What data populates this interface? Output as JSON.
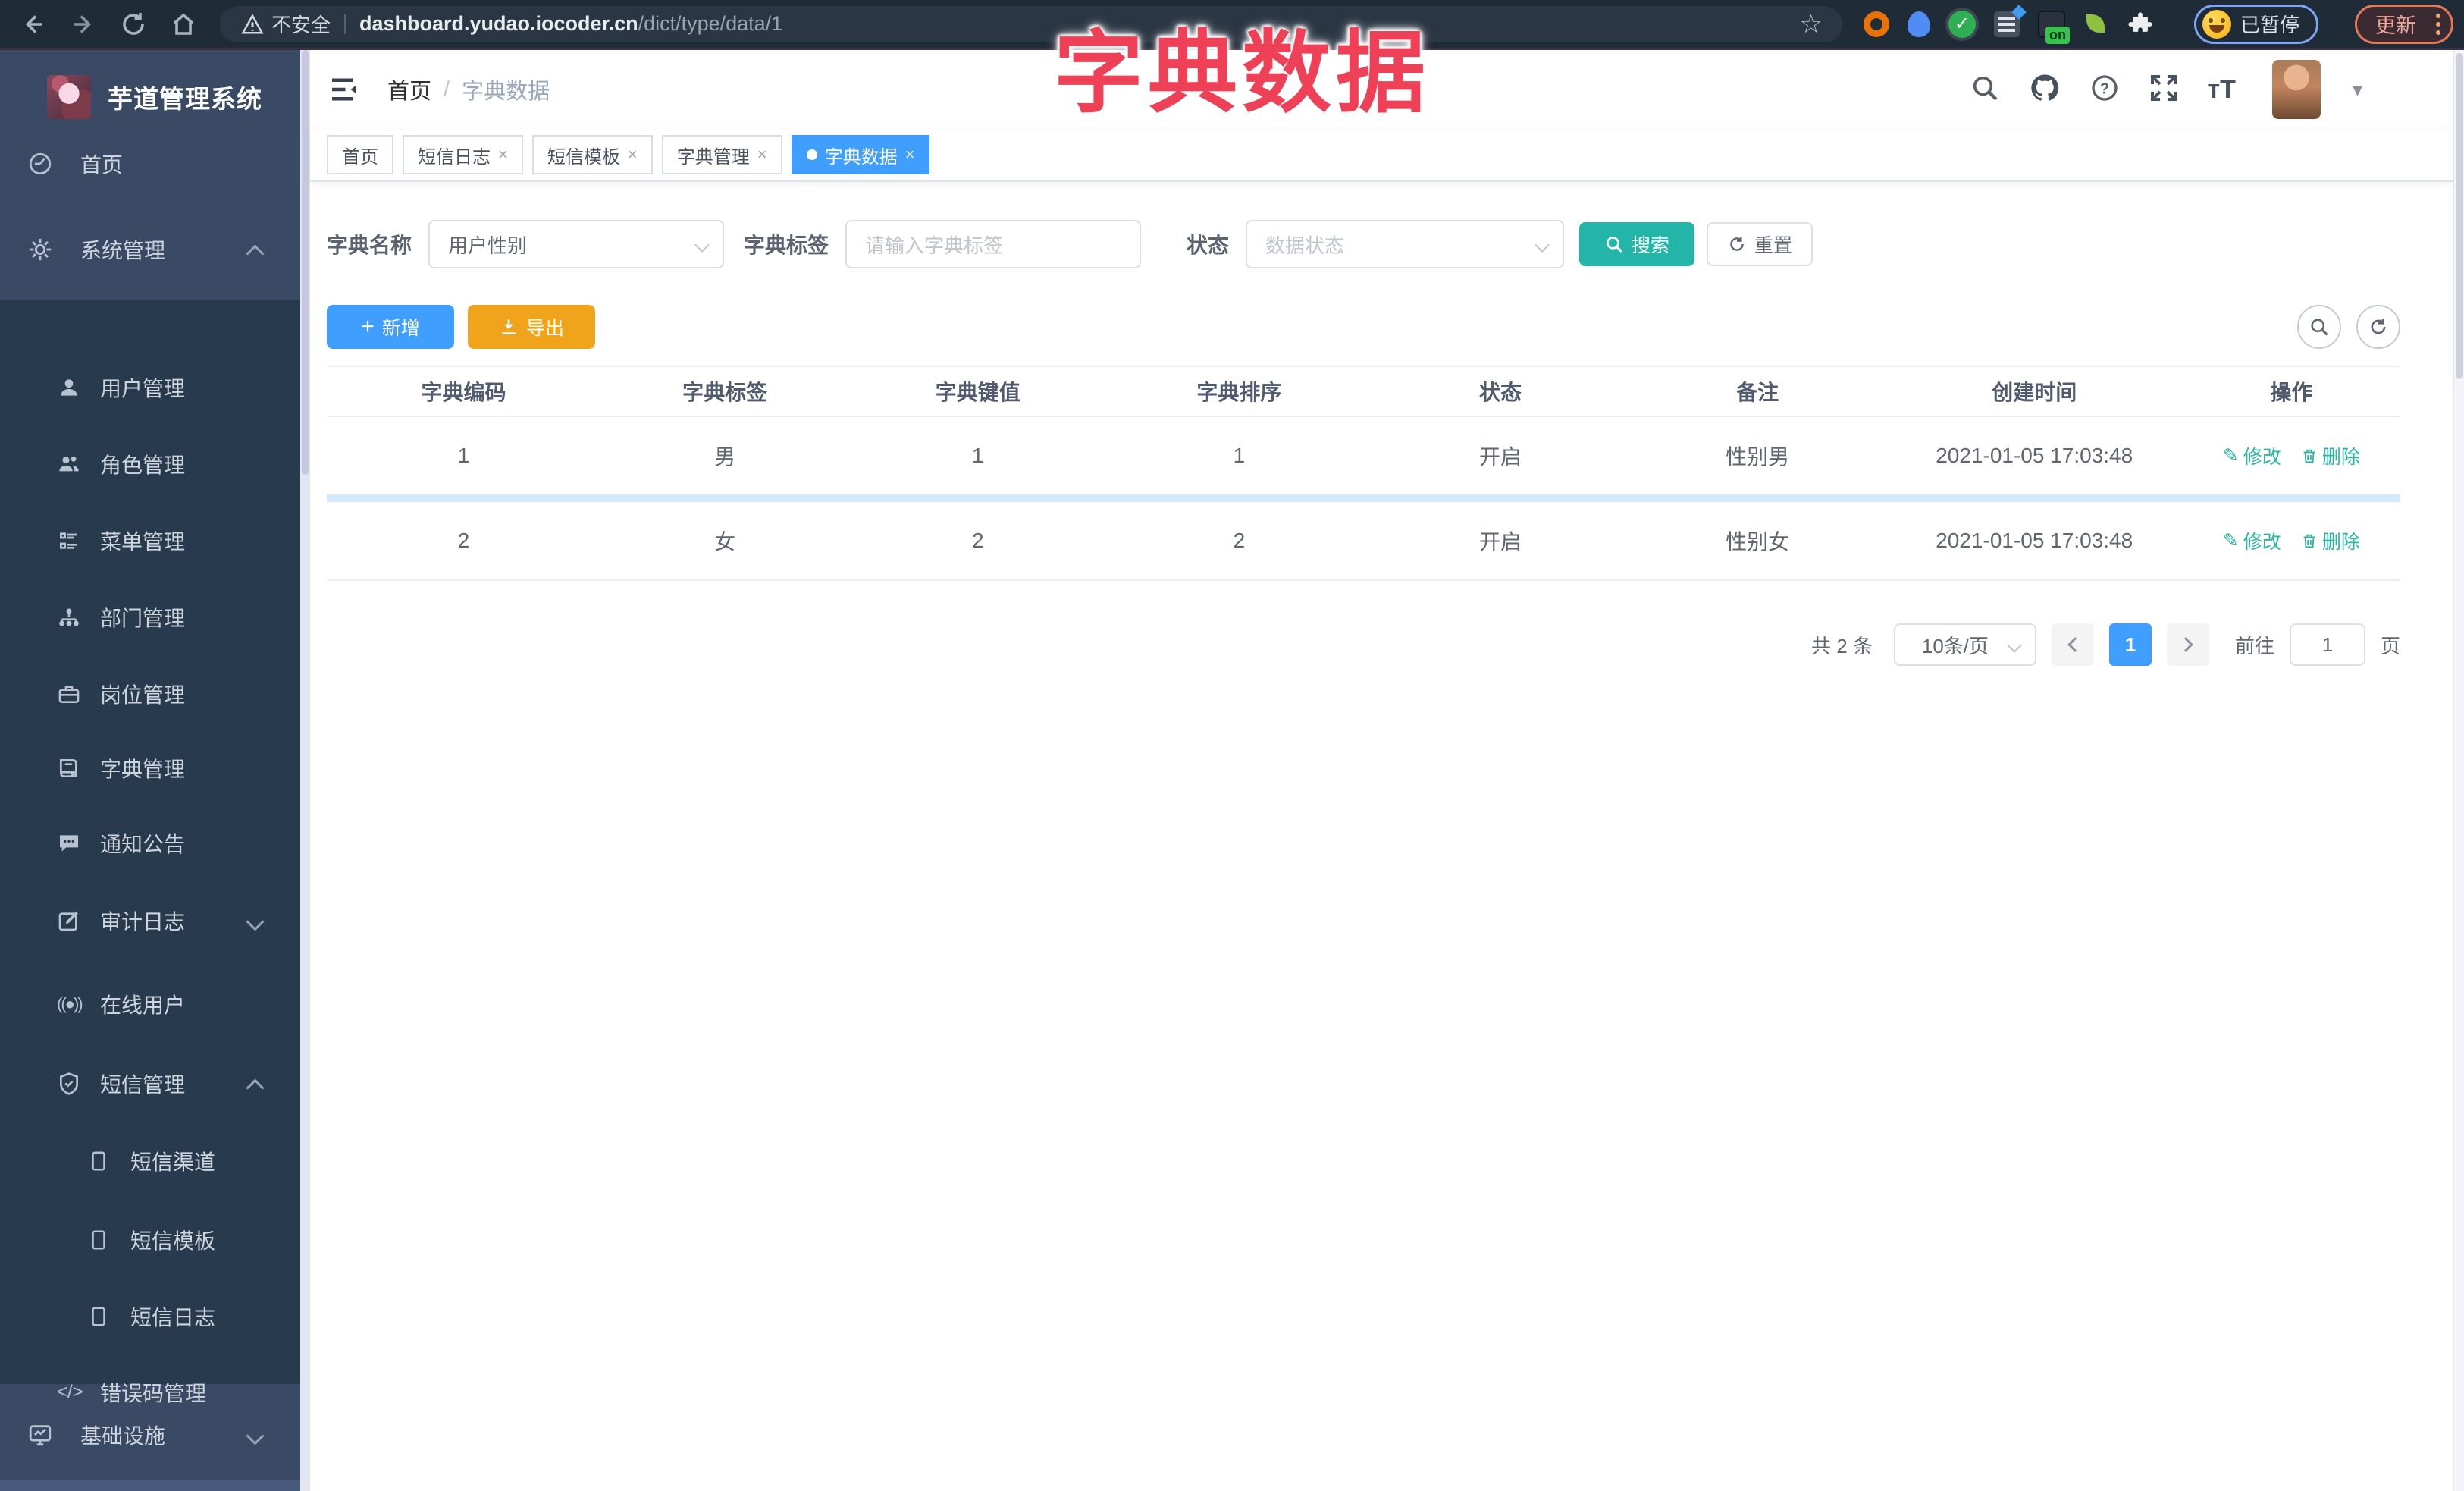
{
  "browser": {
    "security_label": "不安全",
    "url_host": "dashboard.yudao.iocoder.cn",
    "url_path": "/dict/type/data/1",
    "extension_on_badge": "on",
    "paused_badge": "已暂停",
    "update_button": "更新"
  },
  "overlay_title": "字典数据",
  "sidebar": {
    "logo_title": "芋道管理系统",
    "items": [
      {
        "label": "首页"
      },
      {
        "label": "系统管理"
      },
      {
        "label": "用户管理"
      },
      {
        "label": "角色管理"
      },
      {
        "label": "菜单管理"
      },
      {
        "label": "部门管理"
      },
      {
        "label": "岗位管理"
      },
      {
        "label": "字典管理"
      },
      {
        "label": "通知公告"
      },
      {
        "label": "审计日志"
      },
      {
        "label": "在线用户"
      },
      {
        "label": "短信管理"
      },
      {
        "label": "短信渠道"
      },
      {
        "label": "短信模板"
      },
      {
        "label": "短信日志"
      },
      {
        "label": "错误码管理"
      },
      {
        "label": "基础设施"
      }
    ]
  },
  "header": {
    "breadcrumb_home": "首页",
    "breadcrumb_sep": "/",
    "breadcrumb_current": "字典数据"
  },
  "tabs": [
    {
      "label": "首页"
    },
    {
      "label": "短信日志"
    },
    {
      "label": "短信模板"
    },
    {
      "label": "字典管理"
    },
    {
      "label": "字典数据"
    }
  ],
  "filters": {
    "name_label": "字典名称",
    "name_value": "用户性别",
    "tag_label": "字典标签",
    "tag_placeholder": "请输入字典标签",
    "status_label": "状态",
    "status_placeholder": "数据状态",
    "search_label": "搜索",
    "reset_label": "重置"
  },
  "toolbar": {
    "add_label": "新增",
    "export_label": "导出"
  },
  "table": {
    "headers": [
      "字典编码",
      "字典标签",
      "字典键值",
      "字典排序",
      "状态",
      "备注",
      "创建时间",
      "操作"
    ],
    "rows": [
      {
        "code": "1",
        "tag": "男",
        "value": "1",
        "sort": "1",
        "status": "开启",
        "remark": "性别男",
        "created": "2021-01-05 17:03:48"
      },
      {
        "code": "2",
        "tag": "女",
        "value": "2",
        "sort": "2",
        "status": "开启",
        "remark": "性别女",
        "created": "2021-01-05 17:03:48"
      }
    ],
    "edit_label": "修改",
    "delete_label": "删除"
  },
  "pagination": {
    "total": "共 2 条",
    "page_size": "10条/页",
    "current_page": "1",
    "goto_prefix": "前往",
    "goto_value": "1",
    "goto_suffix": "页"
  },
  "colors": {
    "accent_blue": "#409eff",
    "teal": "#23b6a8",
    "warning_orange": "#f0a41c",
    "title_red": "#ee4056",
    "sidebar_base": "#3a4a64",
    "sidebar_sub": "#283a4e"
  }
}
